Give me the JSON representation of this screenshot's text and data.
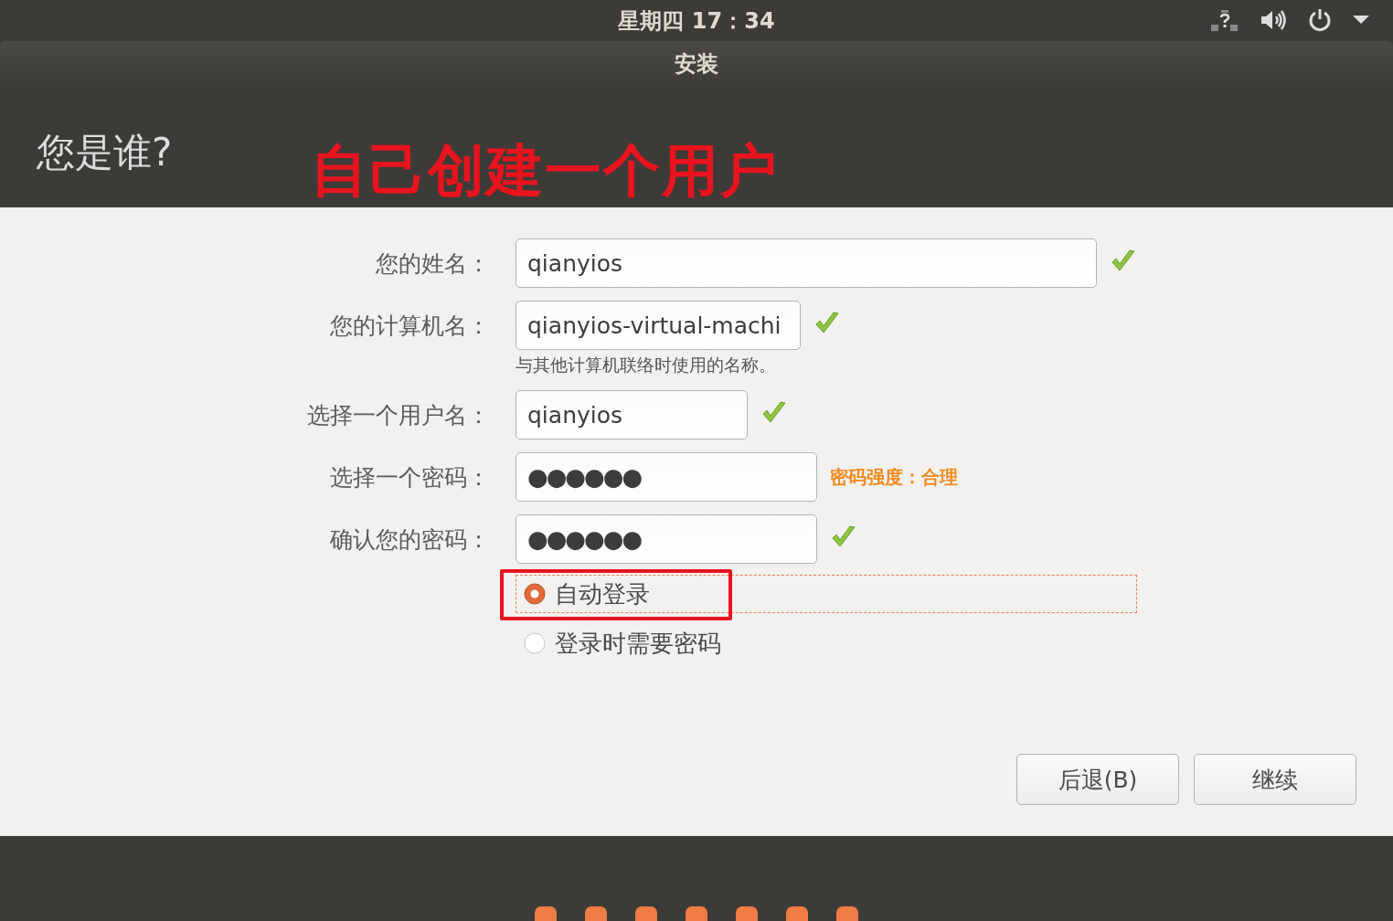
{
  "top_bar": {
    "clock": "星期四 17：34"
  },
  "window": {
    "title": "安装"
  },
  "header": {
    "title": "您是谁?"
  },
  "annotation": {
    "text": "自己创建一个用户"
  },
  "fields": [
    {
      "label": "您的姓名：",
      "value": "qianyios",
      "check": true
    },
    {
      "label": "您的计算机名：",
      "value": "qianyios-virtual-machi",
      "check": true,
      "hint": "与其他计算机联络时使用的名称。"
    },
    {
      "label": "选择一个用户名：",
      "value": "qianyios",
      "check": true
    },
    {
      "label": "选择一个密码：",
      "value": "●●●●●●",
      "check": false,
      "strength": "密码强度：合理"
    },
    {
      "label": "确认您的密码：",
      "value": "●●●●●●",
      "check": true
    }
  ],
  "login_options": [
    {
      "label": "自动登录",
      "selected": true,
      "focused": true
    },
    {
      "label": "登录时需要密码",
      "selected": false,
      "focused": false
    }
  ],
  "buttons": [
    "后退(B)",
    "继续"
  ]
}
